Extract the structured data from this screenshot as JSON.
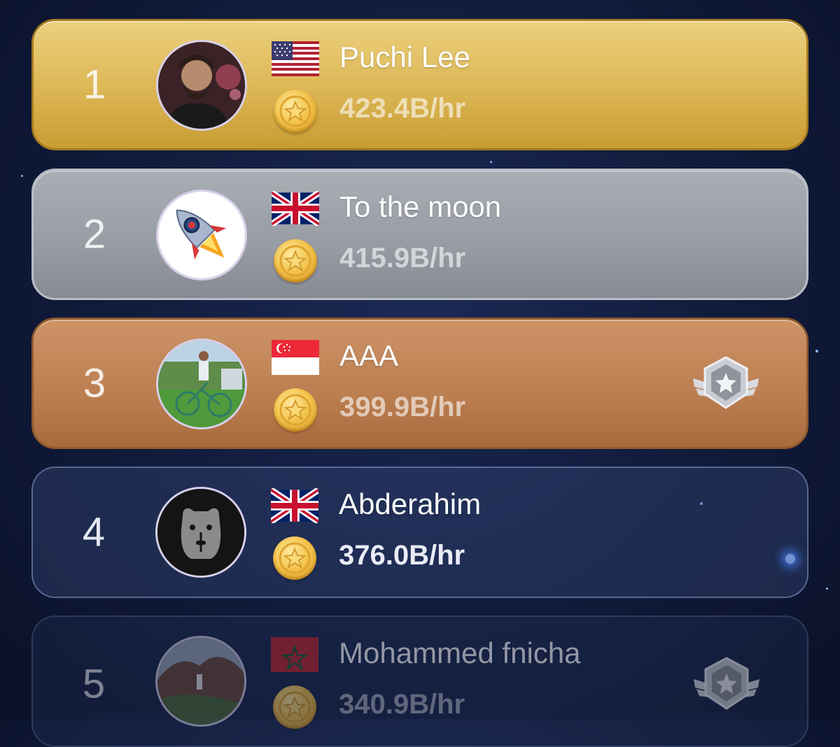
{
  "leaderboard": [
    {
      "rank": "1",
      "name": "Puchi Lee",
      "rate": "423.4B/hr",
      "flag": "us-flag",
      "avatar": "man-photo",
      "tier": "gold",
      "badge": false
    },
    {
      "rank": "2",
      "name": "To the moon",
      "rate": "415.9B/hr",
      "flag": "uk-flag",
      "avatar": "rocket",
      "tier": "silver",
      "badge": false
    },
    {
      "rank": "3",
      "name": "AAA",
      "rate": "399.9B/hr",
      "flag": "singapore-flag",
      "avatar": "bicycle-photo",
      "tier": "bronze",
      "badge": true
    },
    {
      "rank": "4",
      "name": "Abderahim",
      "rate": "376.0B/hr",
      "flag": "uk-flag",
      "avatar": "capybara-logo",
      "tier": "plain",
      "badge": false
    },
    {
      "rank": "5",
      "name": "Mohammed fnicha",
      "rate": "340.9B/hr",
      "flag": "morocco-flag",
      "avatar": "landscape-photo",
      "tier": "plain",
      "badge": true
    }
  ],
  "colors": {
    "gold": "#dcb654",
    "silver": "#979ba3",
    "bronze": "#bb7e50",
    "background": "#101a3a",
    "coin": "#f3c54e"
  }
}
